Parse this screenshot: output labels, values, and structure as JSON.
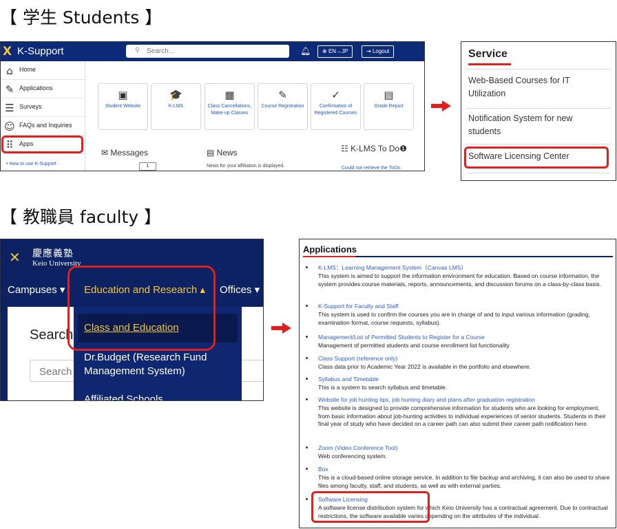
{
  "titles": {
    "students": "【 学生  Students 】",
    "faculty": "【 教職員  faculty 】"
  },
  "colors": {
    "navy": "#0d2a78",
    "gold": "#f2c53d",
    "highlight_red": "#e0201c",
    "link_blue": "#2457c5"
  },
  "ksupport": {
    "logo_mark": "X",
    "logo_text": "K-Support",
    "search_placeholder": "Search...",
    "search_icon": "search-icon",
    "bell_icon": "bell-icon",
    "lang_button": "EN→JP",
    "logout_button": "Logout",
    "sidebar": [
      {
        "label": "Home",
        "icon": "home-icon",
        "glyph": "⌂"
      },
      {
        "label": "Applications",
        "icon": "edit-document-icon",
        "glyph": "✎"
      },
      {
        "label": "Surveys",
        "icon": "checklist-icon",
        "glyph": "☰"
      },
      {
        "label": "FAQs and Inquiries",
        "icon": "help-person-icon",
        "glyph": "☺"
      },
      {
        "label": "Apps",
        "icon": "apps-grid-icon",
        "glyph": "⠿"
      }
    ],
    "sidebar_link": "• How to use K-Support",
    "tiles": [
      {
        "label": "Student Website",
        "icon": "monitor-icon",
        "glyph": "▣"
      },
      {
        "label": "K-LMS",
        "icon": "graduation-cap-icon",
        "glyph": "🎓"
      },
      {
        "label": "Class Cancellations, Make-up Classes",
        "icon": "calendar-icon",
        "glyph": "▦"
      },
      {
        "label": "Course Registration",
        "icon": "pencil-sparkle-icon",
        "glyph": "✎"
      },
      {
        "label": "Confirmation of Registered Courses",
        "icon": "checkmark-icon",
        "glyph": "✓"
      },
      {
        "label": "Grade Report",
        "icon": "clipboard-icon",
        "glyph": "▤"
      }
    ],
    "messages_label": "Messages",
    "messages_count": "1",
    "news_label": "News",
    "news_note": "News for your affiliation is displayed.",
    "todo_label": "K-LMS To Do",
    "todo_note": "Could not retrieve the ToDo."
  },
  "service": {
    "title": "Service",
    "items": [
      "Web-Based Courses for IT Utilization",
      "Notification System for new students",
      "Software Licensing Center"
    ]
  },
  "keio": {
    "logo_mark": "✕",
    "logo_jp": "慶應義塾",
    "logo_en": "Keio University",
    "nav": [
      {
        "label": "Campuses ▾"
      },
      {
        "label": "Education and Research ▴"
      },
      {
        "label": "Offices ▾"
      }
    ],
    "search_heading": "Search",
    "search_placeholder": "Search",
    "dropdown": [
      "Class and Education",
      "Dr.Budget (Research Fund Management System)",
      "Affiliated Schools"
    ]
  },
  "applications": {
    "title": "Applications",
    "items": [
      {
        "name": "K-LMS：Learning Management System（Canvas LMS）",
        "desc": "This system is aimed to support the information environment for education. Based on course information, the system provides course materials, reports, announcements, and discussion forums on a class-by-class basis."
      },
      {
        "name": "K-Support for Faculty and Staff",
        "desc": "This system is used to confirm the courses you are in charge of and to input various information (grading, examination format, course requests, syllabus)."
      },
      {
        "name": "Management/List of Permitted Students to Register for a Course",
        "desc": "Management of permitted students and course enrollment list functionality"
      },
      {
        "name": "Class Support (reference only)",
        "desc": "Class data prior to Academic Year 2022 is available in the portfolio and elsewhere."
      },
      {
        "name": "Syllabus and Timetable",
        "desc": "This is a system to search syllabus and timetable."
      },
      {
        "name": "Website for job hunting tips, job hunting diary and plans after graduation registration",
        "desc": "This website is designed to provide comprehensive information for students who are looking for employment, from basic information about job-hunting activities to individual experiences of senior students. Students in their final year of study who have decided on a career path can also submit their career path notification here."
      },
      {
        "name": "Zoom (Video Conference Tool)",
        "desc": "Web conferencing system."
      },
      {
        "name": "Box",
        "desc": "This is a cloud-based online storage service. In addition to file backup and archiving, it can also be used to share files among faculty, staff, and students, as well as with external parties."
      },
      {
        "name": "Software Licensing",
        "desc": "A software license distribution system for which Keio University has a contractual agreement. Due to contractual restrictions, the software available varies depending on the attributes of the individual."
      }
    ]
  }
}
